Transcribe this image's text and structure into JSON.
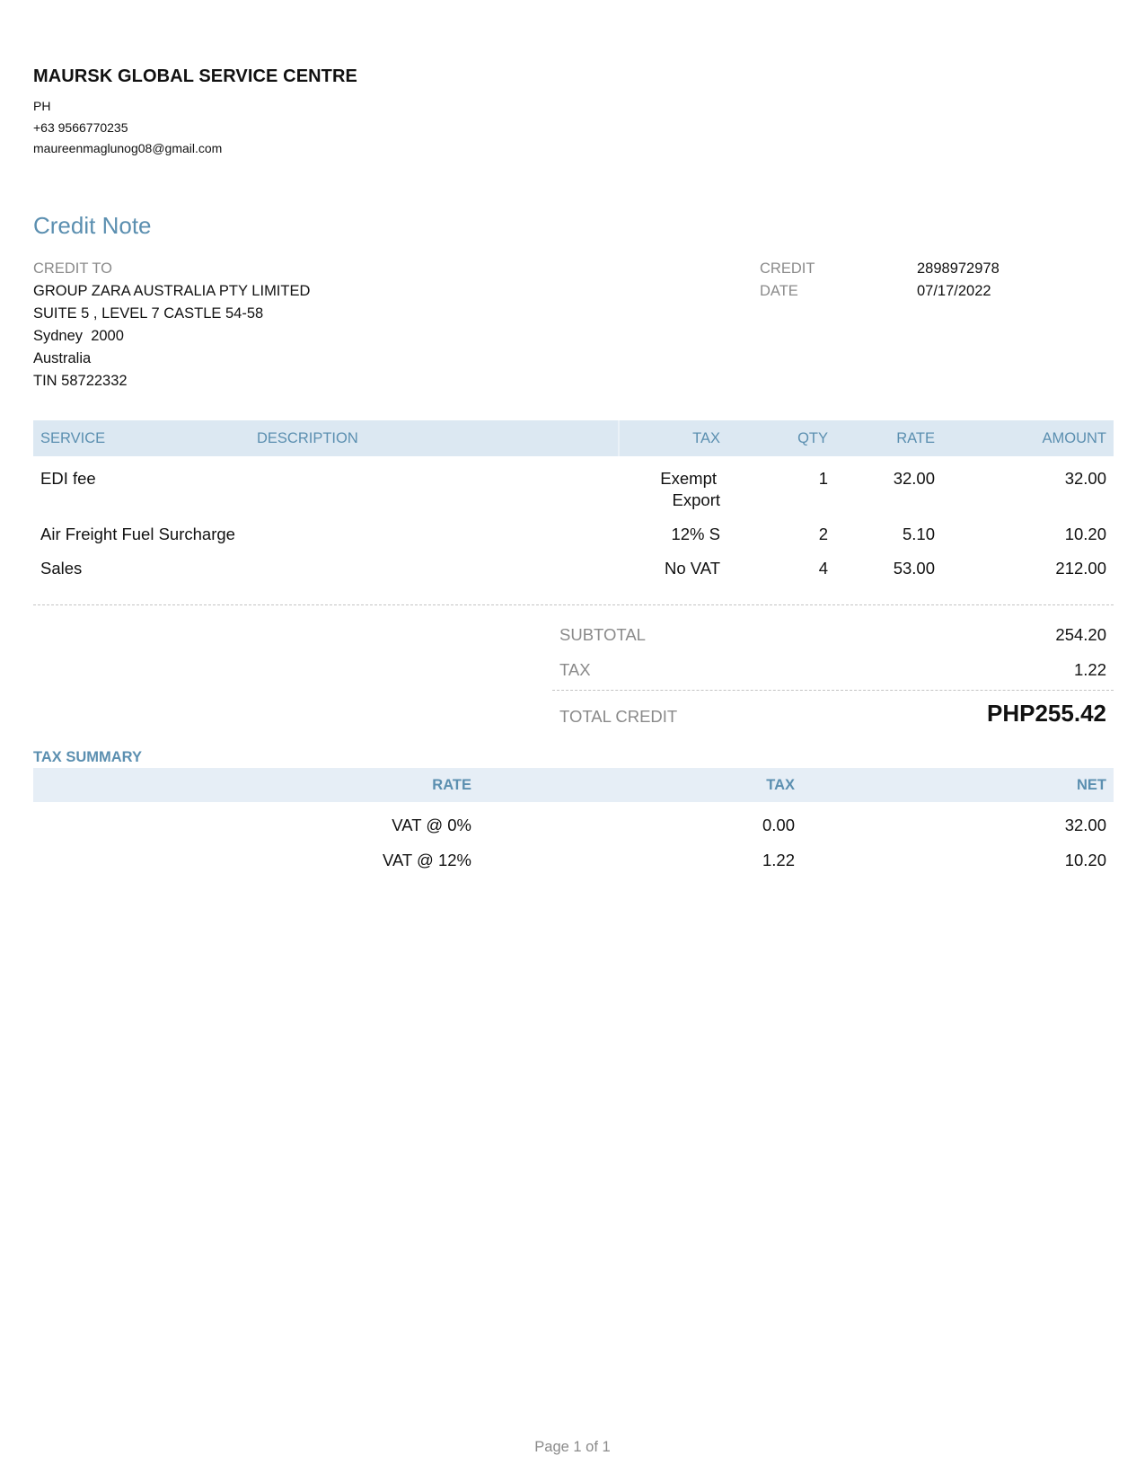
{
  "company": {
    "name": "MAURSK GLOBAL SERVICE CENTRE",
    "country": "PH",
    "phone": "+63 9566770235",
    "email": "maureenmaglunog08@gmail.com"
  },
  "document": {
    "title": "Credit Note"
  },
  "credit_to": {
    "label": "CREDIT TO",
    "lines": [
      "GROUP ZARA AUSTRALIA PTY LIMITED",
      "SUITE 5 , LEVEL 7 CASTLE 54-58",
      "Sydney  2000",
      "Australia",
      "TIN 58722332"
    ]
  },
  "meta": {
    "credit_label": "CREDIT",
    "credit_value": "2898972978",
    "date_label": "DATE",
    "date_value": "07/17/2022"
  },
  "items": {
    "headers": {
      "service": "SERVICE",
      "description": "DESCRIPTION",
      "tax": "TAX",
      "qty": "QTY",
      "rate": "RATE",
      "amount": "AMOUNT"
    },
    "rows": [
      {
        "service": "EDI fee",
        "description": "",
        "tax_line1": "Exempt",
        "tax_line2": "Export",
        "qty": "1",
        "rate": "32.00",
        "amount": "32.00"
      },
      {
        "service": "Air Freight Fuel Surcharge",
        "description": "",
        "tax_line1": "12% S",
        "tax_line2": "",
        "qty": "2",
        "rate": "5.10",
        "amount": "10.20"
      },
      {
        "service": "Sales",
        "description": "",
        "tax_line1": "No VAT",
        "tax_line2": "",
        "qty": "4",
        "rate": "53.00",
        "amount": "212.00"
      }
    ]
  },
  "totals": {
    "subtotal_label": "SUBTOTAL",
    "subtotal_value": "254.20",
    "tax_label": "TAX",
    "tax_value": "1.22",
    "total_label": "TOTAL CREDIT",
    "total_value": "PHP255.42"
  },
  "tax_summary": {
    "title": "TAX SUMMARY",
    "headers": {
      "rate": "RATE",
      "tax": "TAX",
      "net": "NET"
    },
    "rows": [
      {
        "rate": "VAT @ 0%",
        "tax": "0.00",
        "net": "32.00"
      },
      {
        "rate": "VAT @ 12%",
        "tax": "1.22",
        "net": "10.20"
      }
    ]
  },
  "footer": {
    "page": "Page 1 of 1"
  }
}
